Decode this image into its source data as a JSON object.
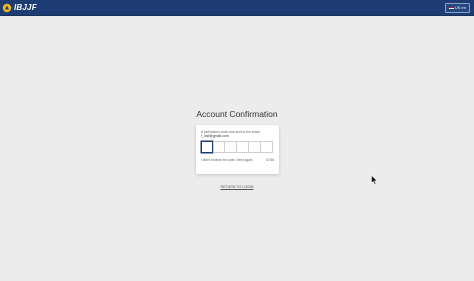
{
  "header": {
    "logo_text": "IBJJF",
    "language_button": "US en",
    "colors": {
      "bar": "#1c3c73",
      "logo_accent": "#f2b51c"
    }
  },
  "main": {
    "title": "Account Confirmation",
    "message": "A verification code was sent to the email",
    "email": "f_lvsf@gmail.com",
    "code_boxes": 6,
    "resend_text": "I didn't receive the code. Send again.",
    "timer": "02:56",
    "return_link": "RETURN TO LOGIN"
  },
  "icons": {
    "logo": "ibjjf-logo-icon",
    "flag": "us-flag-icon",
    "cursor": "mouse-pointer-icon"
  }
}
